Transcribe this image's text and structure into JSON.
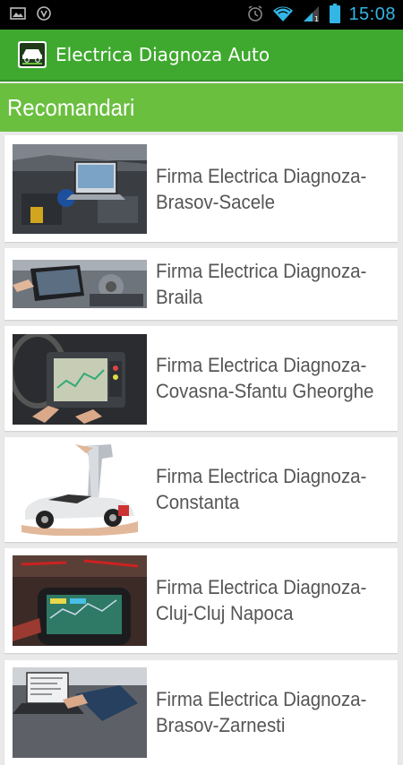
{
  "status_bar": {
    "time": "15:08",
    "icons": [
      "image-icon",
      "shield-icon",
      "alarm-icon",
      "wifi-icon",
      "signal-icon",
      "battery-icon"
    ]
  },
  "app_bar": {
    "title": "Electrica Diagnoza Auto",
    "logo": "car-logo-icon",
    "color": "#3fa92f"
  },
  "section": {
    "title": "Recomandari",
    "color": "#6abf3f"
  },
  "items": [
    {
      "line1": "Firma Electrica Diagnoza-",
      "line2": "Brasov-Sacele",
      "image": "engine-laptop-photo"
    },
    {
      "line1": "Firma Electrica Diagnoza-",
      "line2": "Braila",
      "image": "tablet-engine-photo"
    },
    {
      "line1": "Firma Electrica Diagnoza-",
      "line2": "Covasna-Sfantu Gheorghe",
      "image": "diagnostic-device-photo"
    },
    {
      "line1": "Firma Electrica Diagnoza-",
      "line2": "Constanta",
      "image": "wrench-car-photo"
    },
    {
      "line1": "Firma Electrica Diagnoza-",
      "line2": "Cluj-Cluj Napoca",
      "image": "scanner-tool-photo"
    },
    {
      "line1": "Firma Electrica Diagnoza-",
      "line2": "Brasov-Zarnesti",
      "image": "laptop-technician-photo"
    }
  ]
}
